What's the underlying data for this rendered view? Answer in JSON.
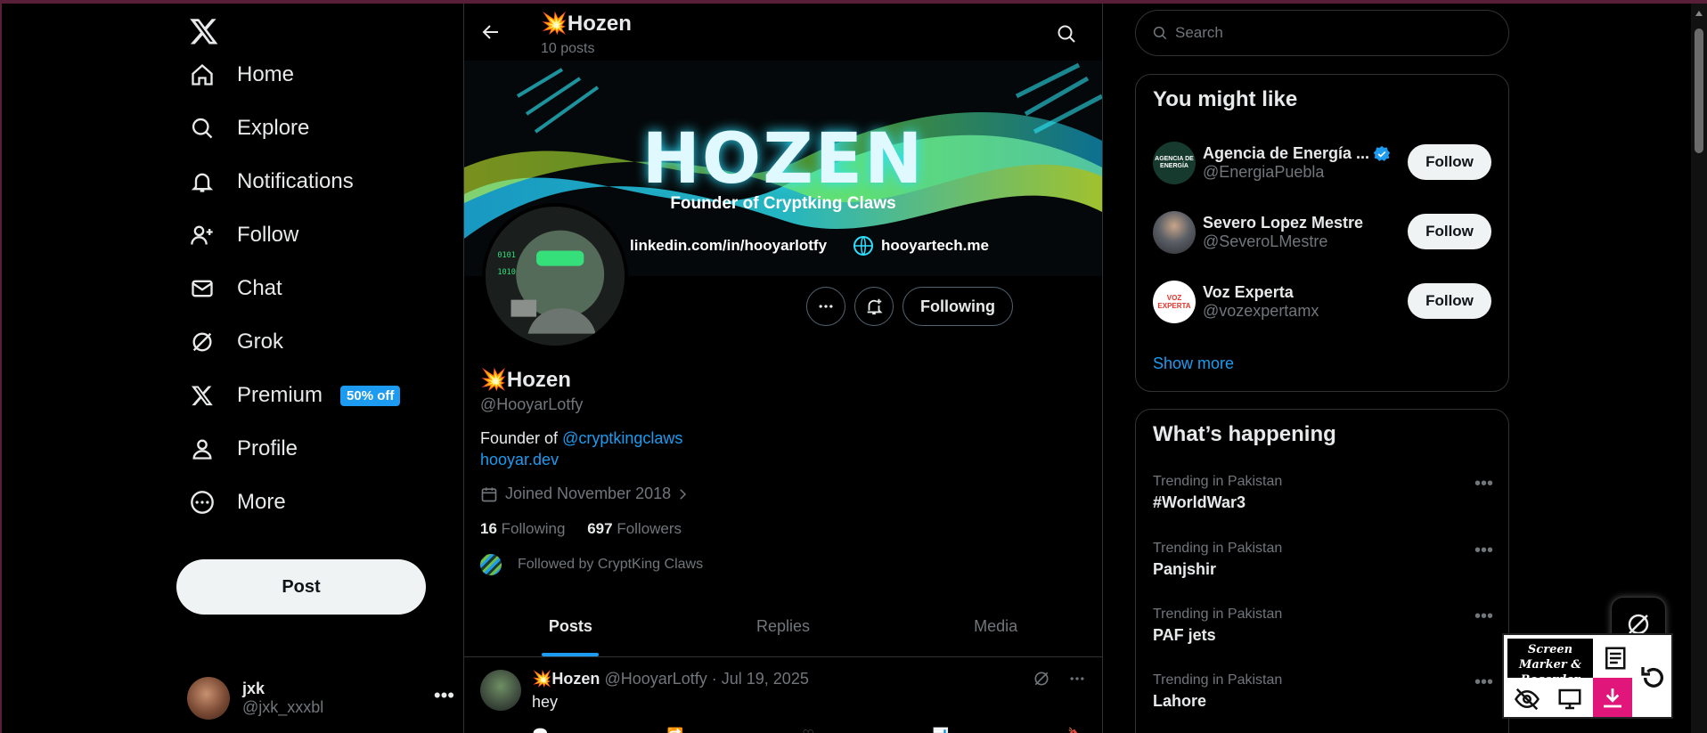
{
  "nav": {
    "items": [
      {
        "label": "Home",
        "icon": "home-icon"
      },
      {
        "label": "Explore",
        "icon": "search-icon"
      },
      {
        "label": "Notifications",
        "icon": "bell-icon"
      },
      {
        "label": "Follow",
        "icon": "add-user-icon"
      },
      {
        "label": "Chat",
        "icon": "mail-icon"
      },
      {
        "label": "Grok",
        "icon": "grok-icon"
      },
      {
        "label": "Premium",
        "icon": "x-logo-icon",
        "badge": "50% off"
      },
      {
        "label": "Profile",
        "icon": "person-icon"
      },
      {
        "label": "More",
        "icon": "more-circle-icon"
      }
    ],
    "post_label": "Post",
    "account": {
      "name": "jxk",
      "handle": "@jxk_xxxbl"
    }
  },
  "header": {
    "name": "Hozen",
    "posts": "10 posts",
    "emoji": "💥"
  },
  "banner": {
    "title": "HOZEN",
    "subtitle": "Founder of Cryptking Claws",
    "linkedin": "linkedin.com/in/hooyarlotfy",
    "website": "hooyartech.me"
  },
  "profile": {
    "name": "Hozen",
    "handle": "@HooyarLotfy",
    "bio_prefix": "Founder of ",
    "bio_mention": "@cryptkingclaws",
    "url": "hooyar.dev",
    "joined": "Joined November 2018",
    "following_count": "16",
    "following_label": "Following",
    "followers_count": "697",
    "followers_label": "Followers",
    "followed_by": "Followed by CryptKing Claws",
    "following_button": "Following"
  },
  "tabs": [
    "Posts",
    "Replies",
    "Media"
  ],
  "tweet": {
    "name": "Hozen",
    "handle": "@HooyarLotfy",
    "date": "Jul 19, 2025",
    "text": "hey"
  },
  "right": {
    "search_placeholder": "Search",
    "you_might_like": "You might like",
    "suggestions": [
      {
        "name": "Agencia de Energía ...",
        "handle": "@EnergiaPuebla",
        "verified": true,
        "avatar_text": "AGENCIA DE ENERGÍA"
      },
      {
        "name": "Severo Lopez Mestre",
        "handle": "@SeveroLMestre",
        "verified": false,
        "avatar_text": ""
      },
      {
        "name": "Voz Experta",
        "handle": "@vozexpertamx",
        "verified": false,
        "avatar_text": "VOZ EXPERTA"
      }
    ],
    "follow_label": "Follow",
    "show_more": "Show more",
    "whats_happening": "What’s happening",
    "trends": [
      {
        "context": "Trending in Pakistan",
        "topic": "#WorldWar3"
      },
      {
        "context": "Trending in Pakistan",
        "topic": "Panjshir"
      },
      {
        "context": "Trending in Pakistan",
        "topic": "PAF jets"
      },
      {
        "context": "Trending in Pakistan",
        "topic": "Lahore"
      }
    ]
  },
  "overlay": {
    "recorder_title": "Screen Marker & Recorder"
  },
  "colors": {
    "accent": "#1d9bf0",
    "background": "#000000",
    "border": "#2f3336",
    "muted": "#71767b"
  }
}
